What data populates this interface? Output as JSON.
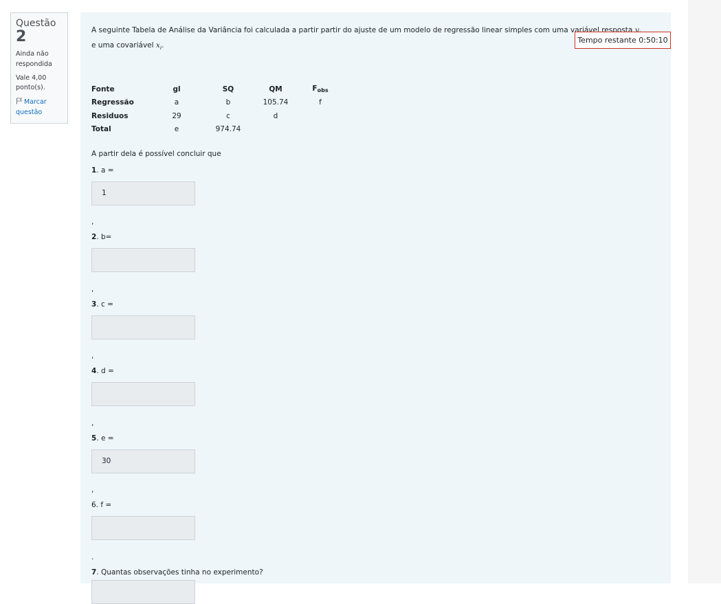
{
  "info": {
    "title": "Questão",
    "number": "2",
    "state": "Ainda não respondida",
    "grade": "Vale 4,00 ponto(s).",
    "flag_label": "Marcar questão"
  },
  "timer": "Tempo restante 0:50:10",
  "question": {
    "text_a": "A seguinte Tabela de Análise da Variância foi calculada a partir partir do ajuste de um modelo de regressão linear simples com uma variável resposta ",
    "var_y": "yi",
    "text_b": " e uma covariável ",
    "var_x": "xi",
    "text_c": "."
  },
  "table": {
    "headers": [
      "Fonte",
      "gl",
      "SQ",
      "QM",
      "F",
      "obs"
    ],
    "rows": [
      [
        "Regressão",
        "a",
        "b",
        "105.74",
        "f"
      ],
      [
        "Residuos",
        "29",
        "c",
        "d",
        ""
      ],
      [
        "Total",
        "e",
        "974.74",
        "",
        ""
      ]
    ]
  },
  "intro": "A partir dela é possível concluir que",
  "items": [
    {
      "num": "1",
      "label": ". a =",
      "value": "1",
      "sep": ","
    },
    {
      "num": "2",
      "label": ". b=",
      "value": "",
      "sep": ","
    },
    {
      "num": "3",
      "label": ". c =",
      "value": "",
      "sep": ","
    },
    {
      "num": "4",
      "label": ". d =",
      "value": "",
      "sep": ","
    },
    {
      "num": "5",
      "label": ". e =",
      "value": "30",
      "sep": ","
    },
    {
      "num": "",
      "label": "6. f =",
      "value": "",
      "sep": "."
    },
    {
      "num": "7",
      "label": ". Quantas observações tinha no experimento?",
      "value": "",
      "sep": ""
    }
  ]
}
